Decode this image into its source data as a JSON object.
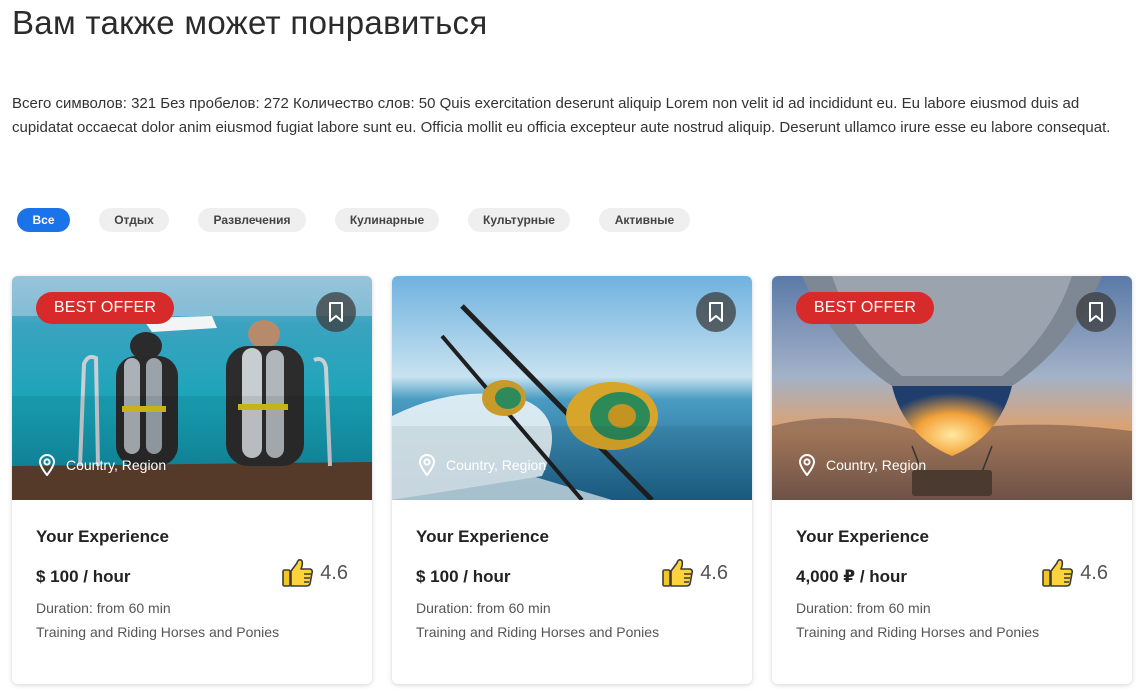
{
  "section": {
    "title": "Вам также может понравиться",
    "description": "Всего символов: 321 Без пробелов: 272 Количество слов: 50 Quis exercitation deserunt aliquip Lorem non velit id ad incididunt eu. Eu labore eiusmod duis ad cupidatat occaecat dolor anim eiusmod fugiat labore sunt eu. Officia mollit eu officia excepteur aute nostrud aliquip. Deserunt ullamco irure esse eu labore consequat."
  },
  "filters": [
    {
      "label": "Все",
      "active": true
    },
    {
      "label": "Отдых",
      "active": false
    },
    {
      "label": "Развлечения",
      "active": false
    },
    {
      "label": "Кулинарные",
      "active": false
    },
    {
      "label": "Культурные",
      "active": false
    },
    {
      "label": "Активные",
      "active": false
    }
  ],
  "cards": [
    {
      "badge": "BEST OFFER",
      "location": "Country, Region",
      "title": "Your Experience",
      "price": "$ 100 / hour",
      "rating": "4.6",
      "duration": "Duration: from 60 min",
      "info": "Training and Riding Horses and Ponies",
      "image": "scuba-divers"
    },
    {
      "badge": "",
      "location": "Country, Region",
      "title": "Your Experience",
      "price": "$ 100 / hour",
      "rating": "4.6",
      "duration": "Duration: from 60 min",
      "info": "Training and Riding Horses and Ponies",
      "image": "fishing-rods"
    },
    {
      "badge": "BEST OFFER",
      "location": "Country, Region",
      "title": "Your Experience",
      "price": "4,000 ₽ / hour",
      "rating": "4.6",
      "duration": "Duration: from 60 min",
      "info": "Training and Riding Horses and Ponies",
      "image": "hot-air-balloon"
    }
  ],
  "icons": {
    "bookmark": "bookmark-icon",
    "location": "location-pin-icon",
    "rating": "thumbs-up-icon"
  },
  "colors": {
    "accent": "#1a73e8",
    "badge": "#d72a2a"
  }
}
